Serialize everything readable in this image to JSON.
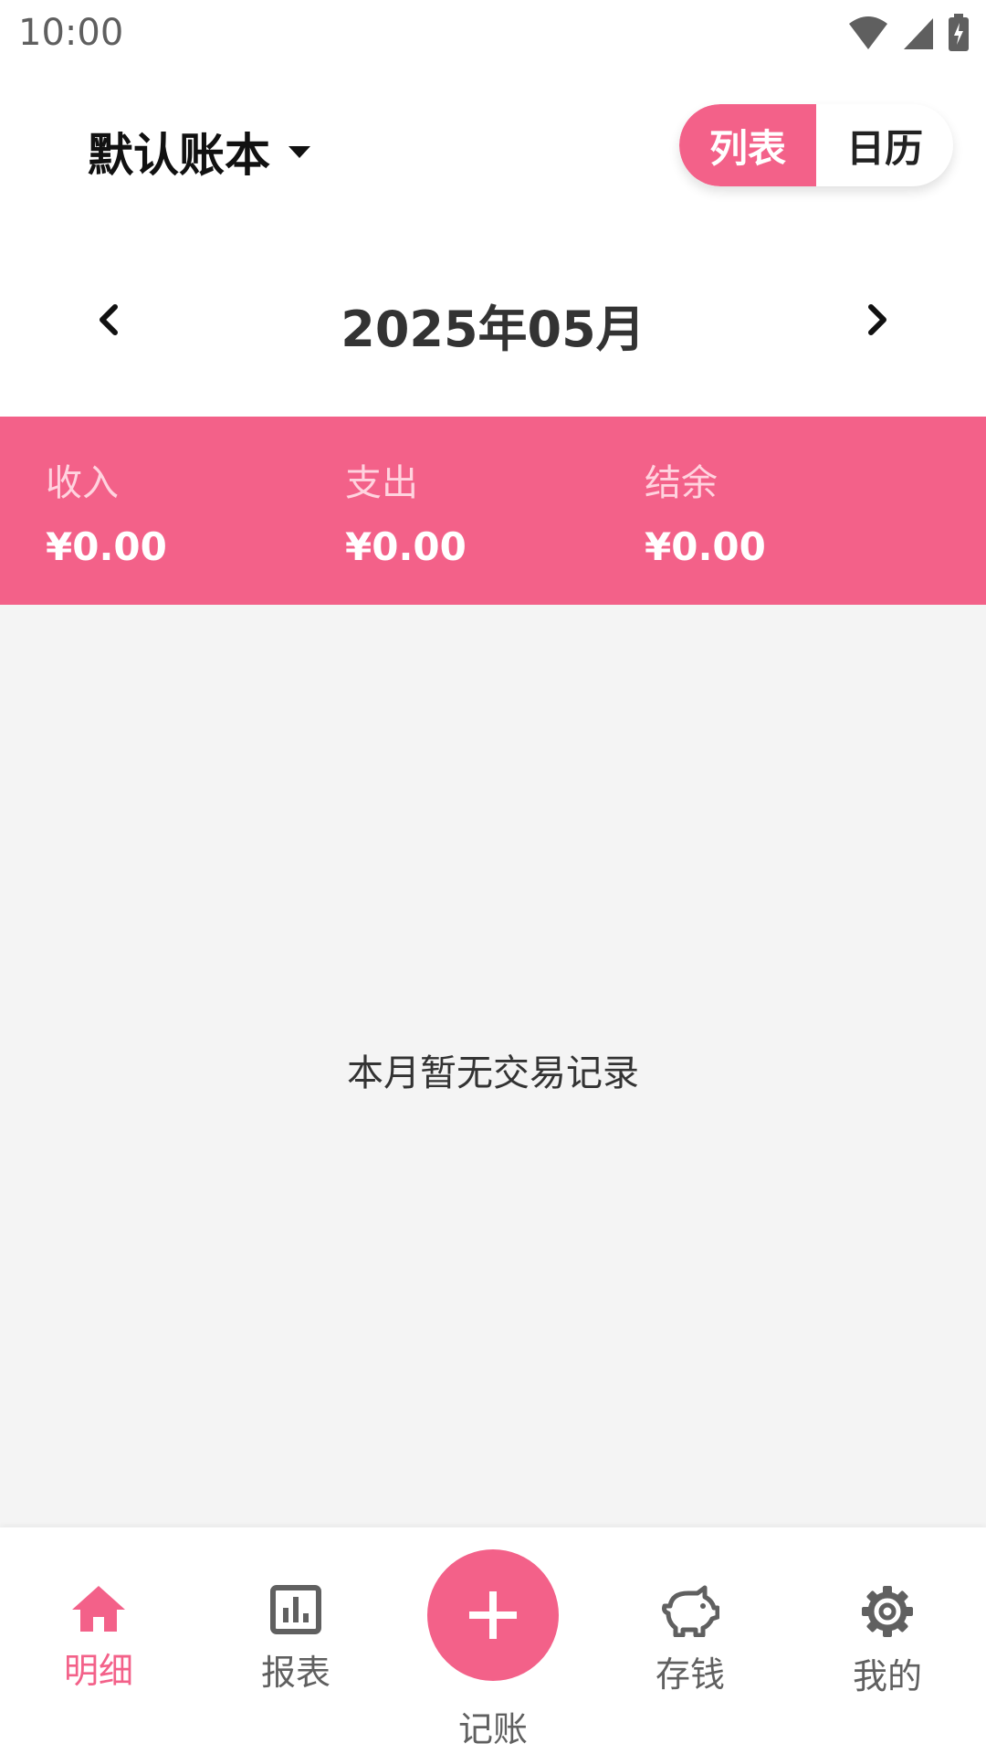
{
  "status_bar": {
    "time": "10:00",
    "icons": [
      "wifi-icon",
      "signal-icon",
      "battery-icon"
    ]
  },
  "header": {
    "ledger_name": "默认账本",
    "view_toggle": {
      "list_label": "列表",
      "calendar_label": "日历",
      "selected": "list"
    }
  },
  "month_nav": {
    "title": "2025年05月",
    "prev_icon": "chevron-left-icon",
    "next_icon": "chevron-right-icon"
  },
  "summary": {
    "income_label": "收入",
    "income_value": "¥0.00",
    "expense_label": "支出",
    "expense_value": "¥0.00",
    "balance_label": "结余",
    "balance_value": "¥0.00"
  },
  "content": {
    "empty_text": "本月暂无交易记录"
  },
  "bottom_nav": {
    "items": [
      {
        "label": "明细",
        "icon": "home-icon",
        "active": true
      },
      {
        "label": "报表",
        "icon": "chart-icon",
        "active": false
      },
      {
        "label": "记账",
        "icon": "plus-icon",
        "active": false
      },
      {
        "label": "存钱",
        "icon": "piggy-bank-icon",
        "active": false
      },
      {
        "label": "我的",
        "icon": "gear-icon",
        "active": false
      }
    ]
  },
  "colors": {
    "accent": "#F36189",
    "content_bg": "#F4F4F4"
  }
}
